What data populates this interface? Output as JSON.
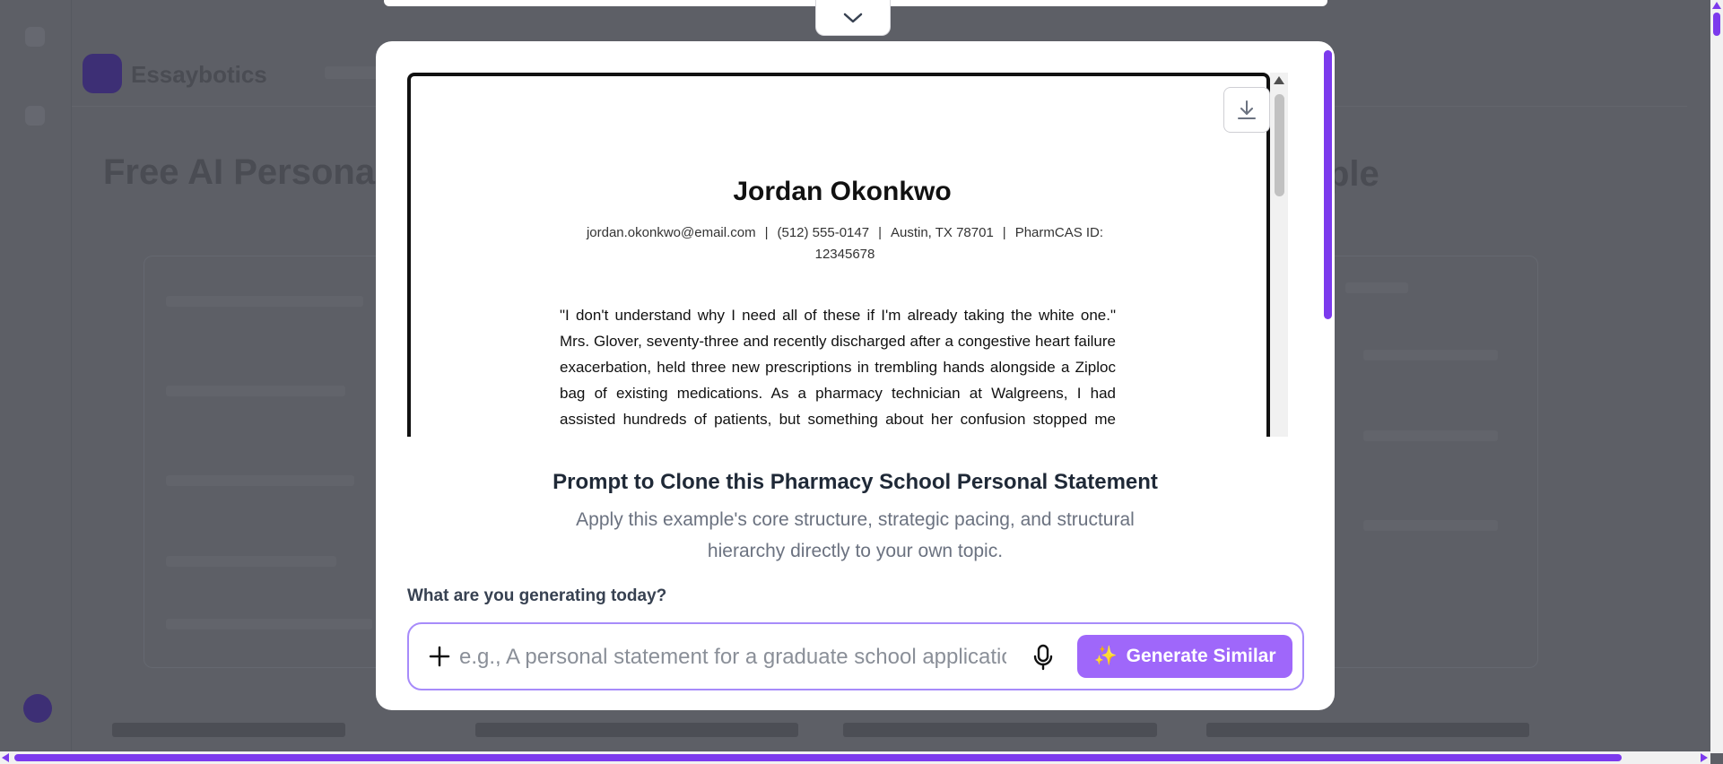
{
  "background": {
    "title_left": "Free AI Personal",
    "title_right": "ple",
    "brand": "Essaybotics"
  },
  "preview": {
    "name": "Jordan Okonkwo",
    "email": "jordan.okonkwo@email.com",
    "phone": "(512) 555-0147",
    "location": "Austin, TX 78701",
    "pharmcas": "PharmCAS ID:",
    "pharmcas_id": "12345678",
    "body": "\"I don't understand why I need all of these if I'm already taking the white one.\" Mrs. Glover, seventy-three and recently discharged after a congestive heart failure exacerbation, held three new prescriptions in trembling hands alongside a Ziploc bag of existing medications. As a pharmacy technician at Walgreens, I had assisted hundreds of patients, but something about her confusion stopped me cold. I sat with her for twenty minutes, and realized, sorting pill bottles, that she"
  },
  "clone": {
    "title": "Prompt to Clone this Pharmacy School Personal Statement",
    "subtitle": "Apply this example's core structure, strategic pacing, and structural hierarchy directly to your own topic.",
    "question": "What are you generating today?",
    "input_placeholder": "e.g., A personal statement for a graduate school application",
    "input_value": "",
    "button_label": "Generate Similar",
    "button_icon": "sparkles-icon"
  },
  "colors": {
    "accent": "#7c3aed",
    "button": "#9f67fa",
    "input_border": "#a78bfa"
  }
}
